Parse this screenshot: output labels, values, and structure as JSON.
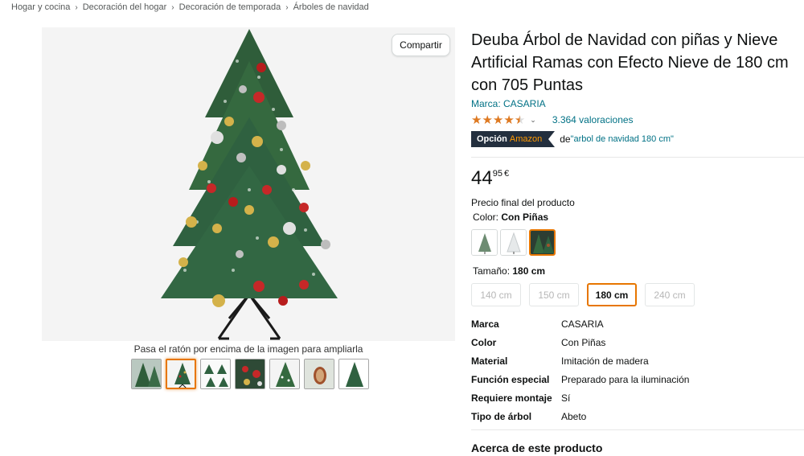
{
  "breadcrumb": [
    "Hogar y cocina",
    "Decoración del hogar",
    "Decoración de temporada",
    "Árboles de navidad"
  ],
  "breadcrumb_separator": "›",
  "gallery": {
    "share_label": "Compartir",
    "hover_hint": "Pasa el ratón por encima de la imagen para ampliarla",
    "selected_thumbnail_index": 1,
    "thumbnail_count": 7
  },
  "product": {
    "title": "Deuba Árbol de Navidad con piñas y Nieve Artificial Ramas con Efecto Nieve de 180 cm con 705 Puntas",
    "brand_link": "Marca: CASARIA",
    "rating_stars": 4.5,
    "ratings_count": "3.364 valoraciones",
    "choice_badge_label": "Opción",
    "choice_badge_brand": "Amazon",
    "choice_de": "de",
    "choice_term": "\"arbol de navidad 180 cm\""
  },
  "price": {
    "whole": "44",
    "fraction": "95",
    "currency": "€",
    "final_label": "Precio final del producto"
  },
  "color": {
    "label": "Color:",
    "selected": "Con Piñas",
    "swatch_count": 3,
    "selected_index": 2
  },
  "size": {
    "label": "Tamaño:",
    "selected": "180 cm",
    "options": [
      "140 cm",
      "150 cm",
      "180 cm",
      "240 cm"
    ],
    "selected_index": 2
  },
  "specs": [
    {
      "key": "Marca",
      "value": "CASARIA"
    },
    {
      "key": "Color",
      "value": "Con Piñas"
    },
    {
      "key": "Material",
      "value": "Imitación de madera"
    },
    {
      "key": "Función especial",
      "value": "Preparado para la iluminación"
    },
    {
      "key": "Requiere montaje",
      "value": "Sí"
    },
    {
      "key": "Tipo de árbol",
      "value": "Abeto"
    }
  ],
  "about_heading": "Acerca de este producto",
  "colors": {
    "link": "#007185",
    "star": "#de7921",
    "selected_border": "#e77600",
    "badge_bg": "#232f3e",
    "badge_accent": "#ff9900"
  }
}
